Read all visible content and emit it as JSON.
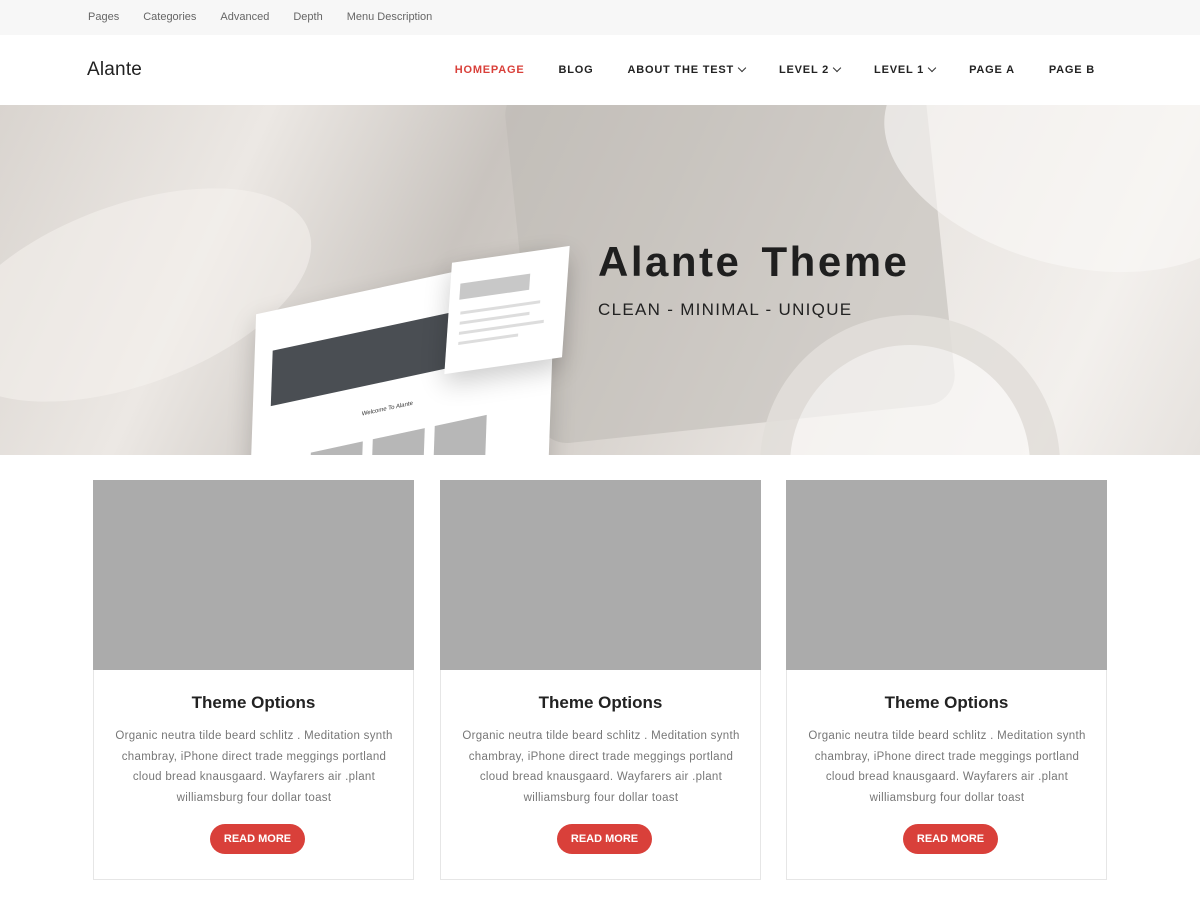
{
  "topbar": {
    "items": [
      "Pages",
      "Categories",
      "Advanced",
      "Depth",
      "Menu Description"
    ]
  },
  "header": {
    "logo": "Alante",
    "nav": [
      {
        "label": "HOMEPAGE",
        "active": true,
        "dropdown": false
      },
      {
        "label": "BLOG",
        "active": false,
        "dropdown": false
      },
      {
        "label": "ABOUT THE TEST",
        "active": false,
        "dropdown": true
      },
      {
        "label": "LEVEL 2",
        "active": false,
        "dropdown": true
      },
      {
        "label": "LEVEL 1",
        "active": false,
        "dropdown": true
      },
      {
        "label": "PAGE A",
        "active": false,
        "dropdown": false
      },
      {
        "label": "PAGE B",
        "active": false,
        "dropdown": false
      }
    ]
  },
  "hero": {
    "title": "Alante  Theme",
    "subtitle": "CLEAN - MINIMAL - UNIQUE",
    "mockup_caption": "Welcome To Alante"
  },
  "cards": [
    {
      "title": "Theme Options",
      "text": "Organic neutra tilde beard schlitz . Meditation synth chambray, iPhone direct trade meggings portland cloud bread knausgaard. Wayfarers air .plant williamsburg four dollar toast",
      "button": "READ MORE"
    },
    {
      "title": "Theme Options",
      "text": "Organic neutra tilde beard schlitz . Meditation synth chambray, iPhone direct trade meggings portland cloud bread knausgaard. Wayfarers air .plant williamsburg four dollar toast",
      "button": "READ MORE"
    },
    {
      "title": "Theme Options",
      "text": "Organic neutra tilde beard schlitz . Meditation synth chambray, iPhone direct trade meggings portland cloud bread knausgaard. Wayfarers air .plant williamsburg four dollar toast",
      "button": "READ MORE"
    }
  ],
  "colors": {
    "accent": "#d9403a",
    "text": "#222222",
    "muted": "#777777",
    "placeholder": "#ababab"
  }
}
